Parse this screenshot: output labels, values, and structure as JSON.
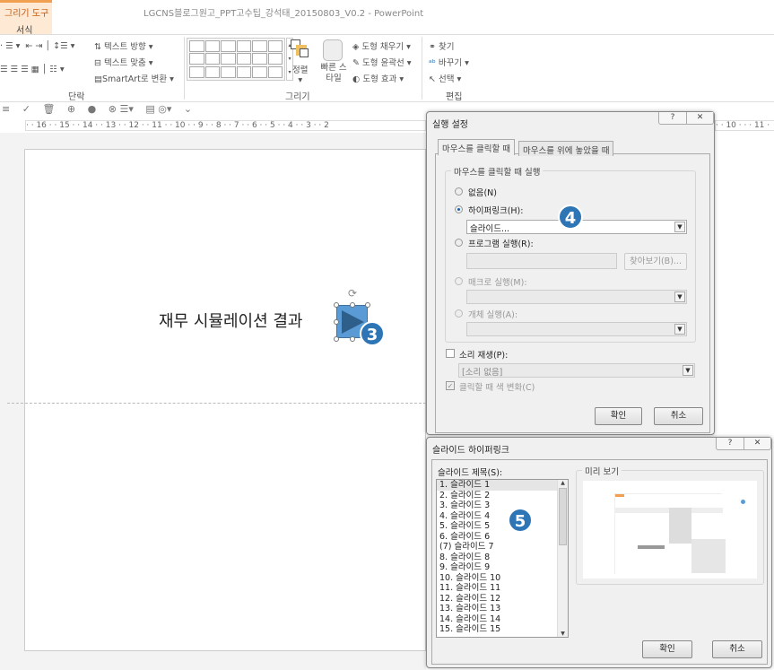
{
  "window": {
    "title": "LGCNS블로그원고_PPT고수팁_강석태_20150803_V0.2 - PowerPoint",
    "context_tab": "그리기 도구",
    "active_tab": "서식"
  },
  "ribbon": {
    "paragraph": {
      "label": "단락",
      "text_direction": "텍스트 방향",
      "align_text": "텍스트 맞춤",
      "smartart": "SmartArt로 변환"
    },
    "drawing": {
      "label": "그리기",
      "arrange": "정렬",
      "quick_styles": "빠른 스타일",
      "shape_fill": "도형 채우기",
      "shape_outline": "도형 윤곽선",
      "shape_effects": "도형 효과"
    },
    "editing": {
      "label": "편집",
      "find": "찾기",
      "replace": "바꾸기",
      "select": "선택"
    }
  },
  "ruler": {
    "ticks_left": [
      "16",
      "15",
      "14",
      "13",
      "12",
      "11",
      "10",
      "9",
      "8",
      "7",
      "6",
      "5",
      "4",
      "3",
      "2"
    ],
    "ticks_right": [
      "10",
      "11"
    ]
  },
  "slide": {
    "text": "재무 시뮬레이션 결과",
    "callouts": [
      "3",
      "4",
      "5"
    ],
    "accent": "#2e75b6",
    "shape_color": "#5b9bd5"
  },
  "action_dialog": {
    "title": "실행 설정",
    "help": "?",
    "close": "✕",
    "tabs": [
      "마우스를 클릭할 때",
      "마우스를 위에 놓았을 때"
    ],
    "group_label": "마우스를 클릭할 때 실행",
    "none": "없음(N)",
    "hyperlink": "하이퍼링크(H):",
    "hyperlink_value": "슬라이드...",
    "run_program": "프로그램 실행(R):",
    "browse": "찾아보기(B)...",
    "run_macro": "매크로 실행(M):",
    "object_action": "개체 실행(A):",
    "play_sound": "소리 재생(P):",
    "sound_value": "[소리 없음]",
    "highlight_click": "클릭할 때 색 변화(C)",
    "ok": "확인",
    "cancel": "취소"
  },
  "hyperlink_dialog": {
    "title": "슬라이드 하이퍼링크",
    "help": "?",
    "close": "✕",
    "list_label": "슬라이드 제목(S):",
    "preview_label": "미리 보기",
    "slides": [
      "1. 슬라이드 1",
      "2. 슬라이드 2",
      "3. 슬라이드 3",
      "4. 슬라이드 4",
      "5. 슬라이드 5",
      "6. 슬라이드 6",
      "(7) 슬라이드 7",
      "8. 슬라이드 8",
      "9. 슬라이드 9",
      "10. 슬라이드 10",
      "11. 슬라이드 11",
      "12. 슬라이드 12",
      "13. 슬라이드 13",
      "14. 슬라이드 14",
      "15. 슬라이드 15"
    ],
    "ok": "확인",
    "cancel": "취소"
  }
}
